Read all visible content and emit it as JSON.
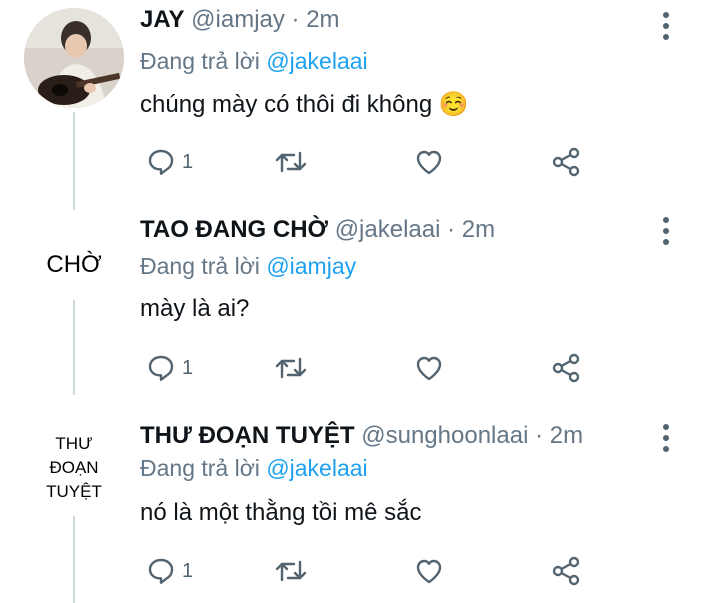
{
  "tweets": [
    {
      "name": "JAY",
      "handle": "@iamjay",
      "time": "· 2m",
      "replying_prefix": "Đang trả lời",
      "replying_to": "@jakelaai",
      "text": "chúng mày có thôi đi không ☺️",
      "reply_count": "1",
      "avatar": {
        "type": "photo",
        "description_icon": "avatar-photo-icon"
      }
    },
    {
      "name": "TAO ĐANG CHỜ",
      "handle": "@jakelaai",
      "time": "· 2m",
      "replying_prefix": "Đang trả lời",
      "replying_to": "@iamjay",
      "text": "mày là ai?",
      "reply_count": "1",
      "avatar": {
        "type": "text",
        "label": "CHỜ"
      }
    },
    {
      "name": "THƯ ĐOẠN TUYỆT",
      "handle": "@sunghoonlaai",
      "time": "· 2m",
      "replying_prefix": "Đang trả lời",
      "replying_to": "@jakelaai",
      "text": "nó là một thằng tồi mê sắc",
      "reply_count": "1",
      "avatar": {
        "type": "text",
        "lines": [
          "THƯ",
          "ĐOẠN",
          "TUYỆT"
        ]
      }
    }
  ],
  "icons": {
    "reply": "reply-icon",
    "retweet": "retweet-icon",
    "like": "heart-icon",
    "share": "share-icon",
    "more": "more-vertical-icon"
  },
  "colors": {
    "mention": "#1da1f2",
    "secondary_text": "#657786",
    "icon": "#536471",
    "thread_line": "#cfd9de"
  }
}
